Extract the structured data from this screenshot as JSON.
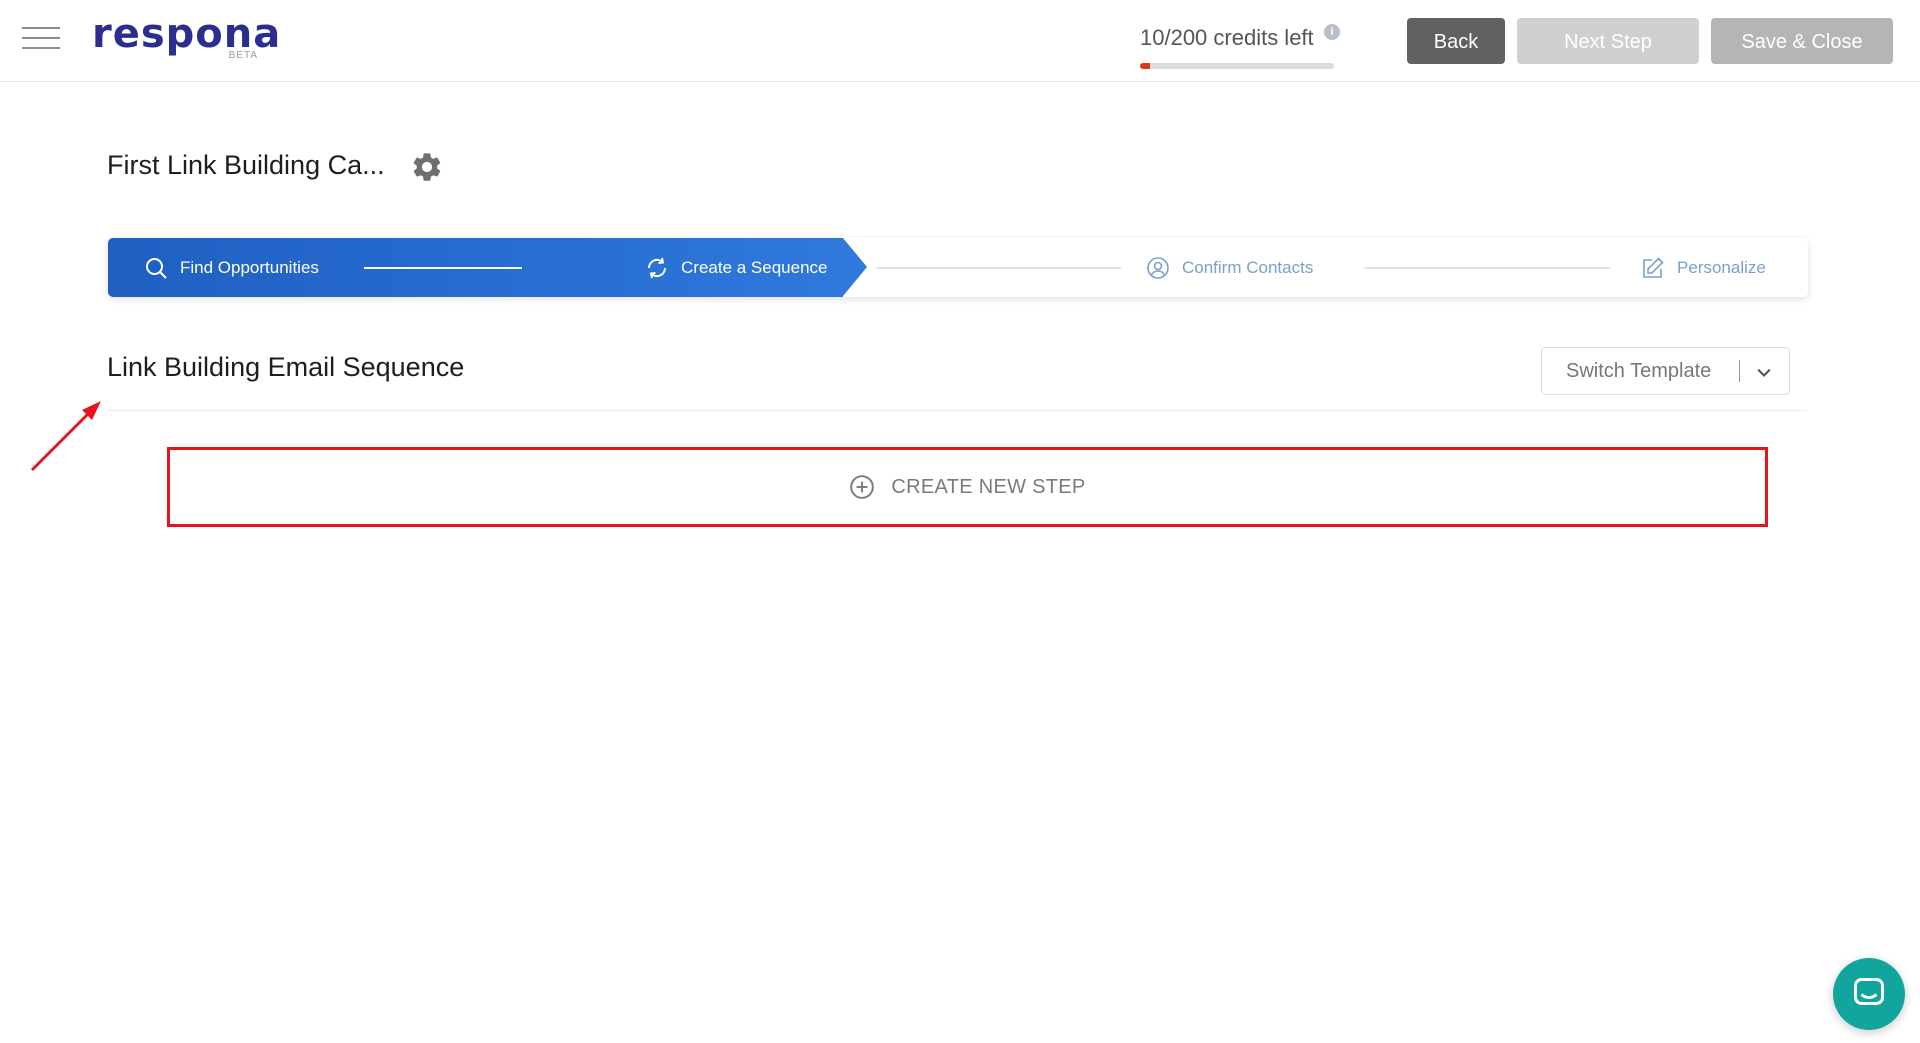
{
  "header": {
    "logo_text": "respona",
    "logo_badge": "BETA",
    "credits_text": "10/200 credits left",
    "credits_used_fraction": 0.05,
    "info_symbol": "i",
    "back_label": "Back",
    "next_label": "Next Step",
    "save_label": "Save & Close"
  },
  "campaign": {
    "title": "First Link Building Ca..."
  },
  "steps": [
    {
      "label": "Find Opportunities",
      "icon": "search-icon",
      "state": "done"
    },
    {
      "label": "Create a Sequence",
      "icon": "refresh-icon",
      "state": "active"
    },
    {
      "label": "Confirm Contacts",
      "icon": "user-circle-icon",
      "state": "pending"
    },
    {
      "label": "Personalize",
      "icon": "edit-icon",
      "state": "pending"
    }
  ],
  "sequence": {
    "title": "Link Building Email Sequence",
    "switch_template_label": "Switch Template",
    "create_step_label": "CREATE NEW STEP"
  },
  "colors": {
    "brand": "#2b2e8c",
    "active_step": "#2f78dc",
    "highlight": "#e8141c",
    "chat": "#12a59e"
  }
}
